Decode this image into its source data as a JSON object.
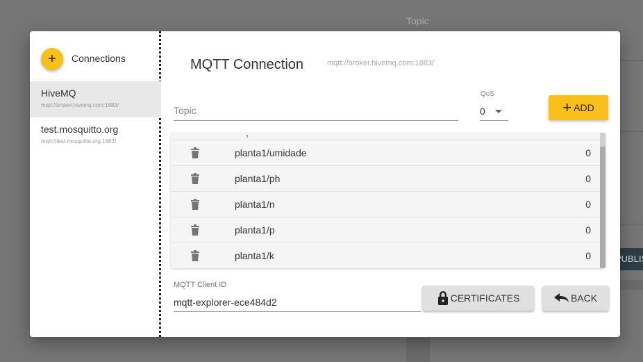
{
  "background": {
    "topic_label": "Topic",
    "publish_label": "PUBLISH"
  },
  "sidebar": {
    "title": "Connections",
    "add_icon": "plus",
    "connections": [
      {
        "name": "HiveMQ",
        "url": "mqtt://broker.hivemq.com:1883/",
        "active": true
      },
      {
        "name": "test.mosquitto.org",
        "url": "mqtt://test.mosquitto.org:1883/",
        "active": false
      }
    ]
  },
  "main": {
    "title": "MQTT Connection",
    "subtitle": "mqtt://broker.hivemq.com:1883/",
    "topic_placeholder": "Topic",
    "qos_label": "QoS",
    "qos_value": "0",
    "add_label": "ADD",
    "subscriptions": [
      {
        "topic": "planta1/umidade",
        "qos": "0"
      },
      {
        "topic": "planta1/ph",
        "qos": "0"
      },
      {
        "topic": "planta1/n",
        "qos": "0"
      },
      {
        "topic": "planta1/p",
        "qos": "0"
      },
      {
        "topic": "planta1/k",
        "qos": "0"
      }
    ],
    "client_id_label": "MQTT Client ID",
    "client_id_value": "mqtt-explorer-ece484d2",
    "certificates_label": "CERTIFICATES",
    "back_label": "BACK"
  },
  "colors": {
    "accent": "#f9c01c",
    "button_grey": "#e0e0e0",
    "icon_grey": "#757575"
  }
}
